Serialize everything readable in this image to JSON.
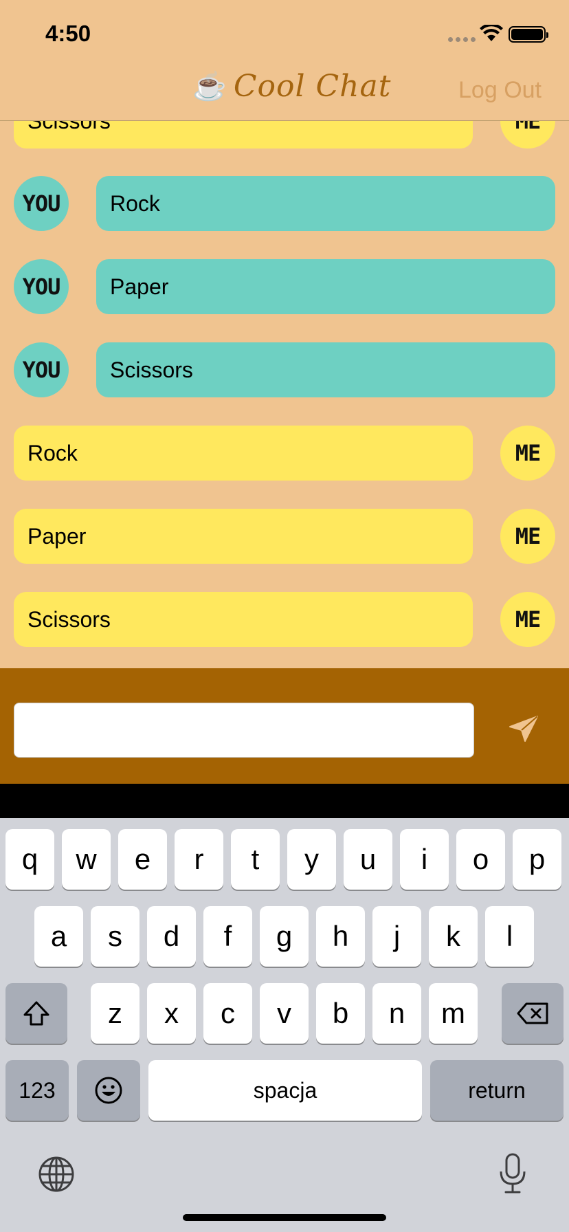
{
  "status_bar": {
    "time": "4:50"
  },
  "nav": {
    "title": "Cool Chat",
    "logout_label": "Log Out",
    "title_icon": "coffee-cup-icon"
  },
  "messages": [
    {
      "sender": "ME",
      "text": "Scissors"
    },
    {
      "sender": "YOU",
      "text": "Rock"
    },
    {
      "sender": "YOU",
      "text": "Paper"
    },
    {
      "sender": "YOU",
      "text": "Scissors"
    },
    {
      "sender": "ME",
      "text": "Rock"
    },
    {
      "sender": "ME",
      "text": "Paper"
    },
    {
      "sender": "ME",
      "text": "Scissors"
    }
  ],
  "compose": {
    "value": "",
    "placeholder": "",
    "send_icon": "paper-plane-icon"
  },
  "keyboard": {
    "row1": [
      "q",
      "w",
      "e",
      "r",
      "t",
      "y",
      "u",
      "i",
      "o",
      "p"
    ],
    "row2": [
      "a",
      "s",
      "d",
      "f",
      "g",
      "h",
      "j",
      "k",
      "l"
    ],
    "row3": [
      "z",
      "x",
      "c",
      "v",
      "b",
      "n",
      "m"
    ],
    "numbers_label": "123",
    "space_label": "spacja",
    "return_label": "return"
  },
  "colors": {
    "background": "#F0C490",
    "me_bubble": "#FFE85E",
    "you_bubble": "#6ED0C2",
    "compose_bar": "#A46303",
    "title": "#A5650F",
    "logout": "#D7A062"
  }
}
